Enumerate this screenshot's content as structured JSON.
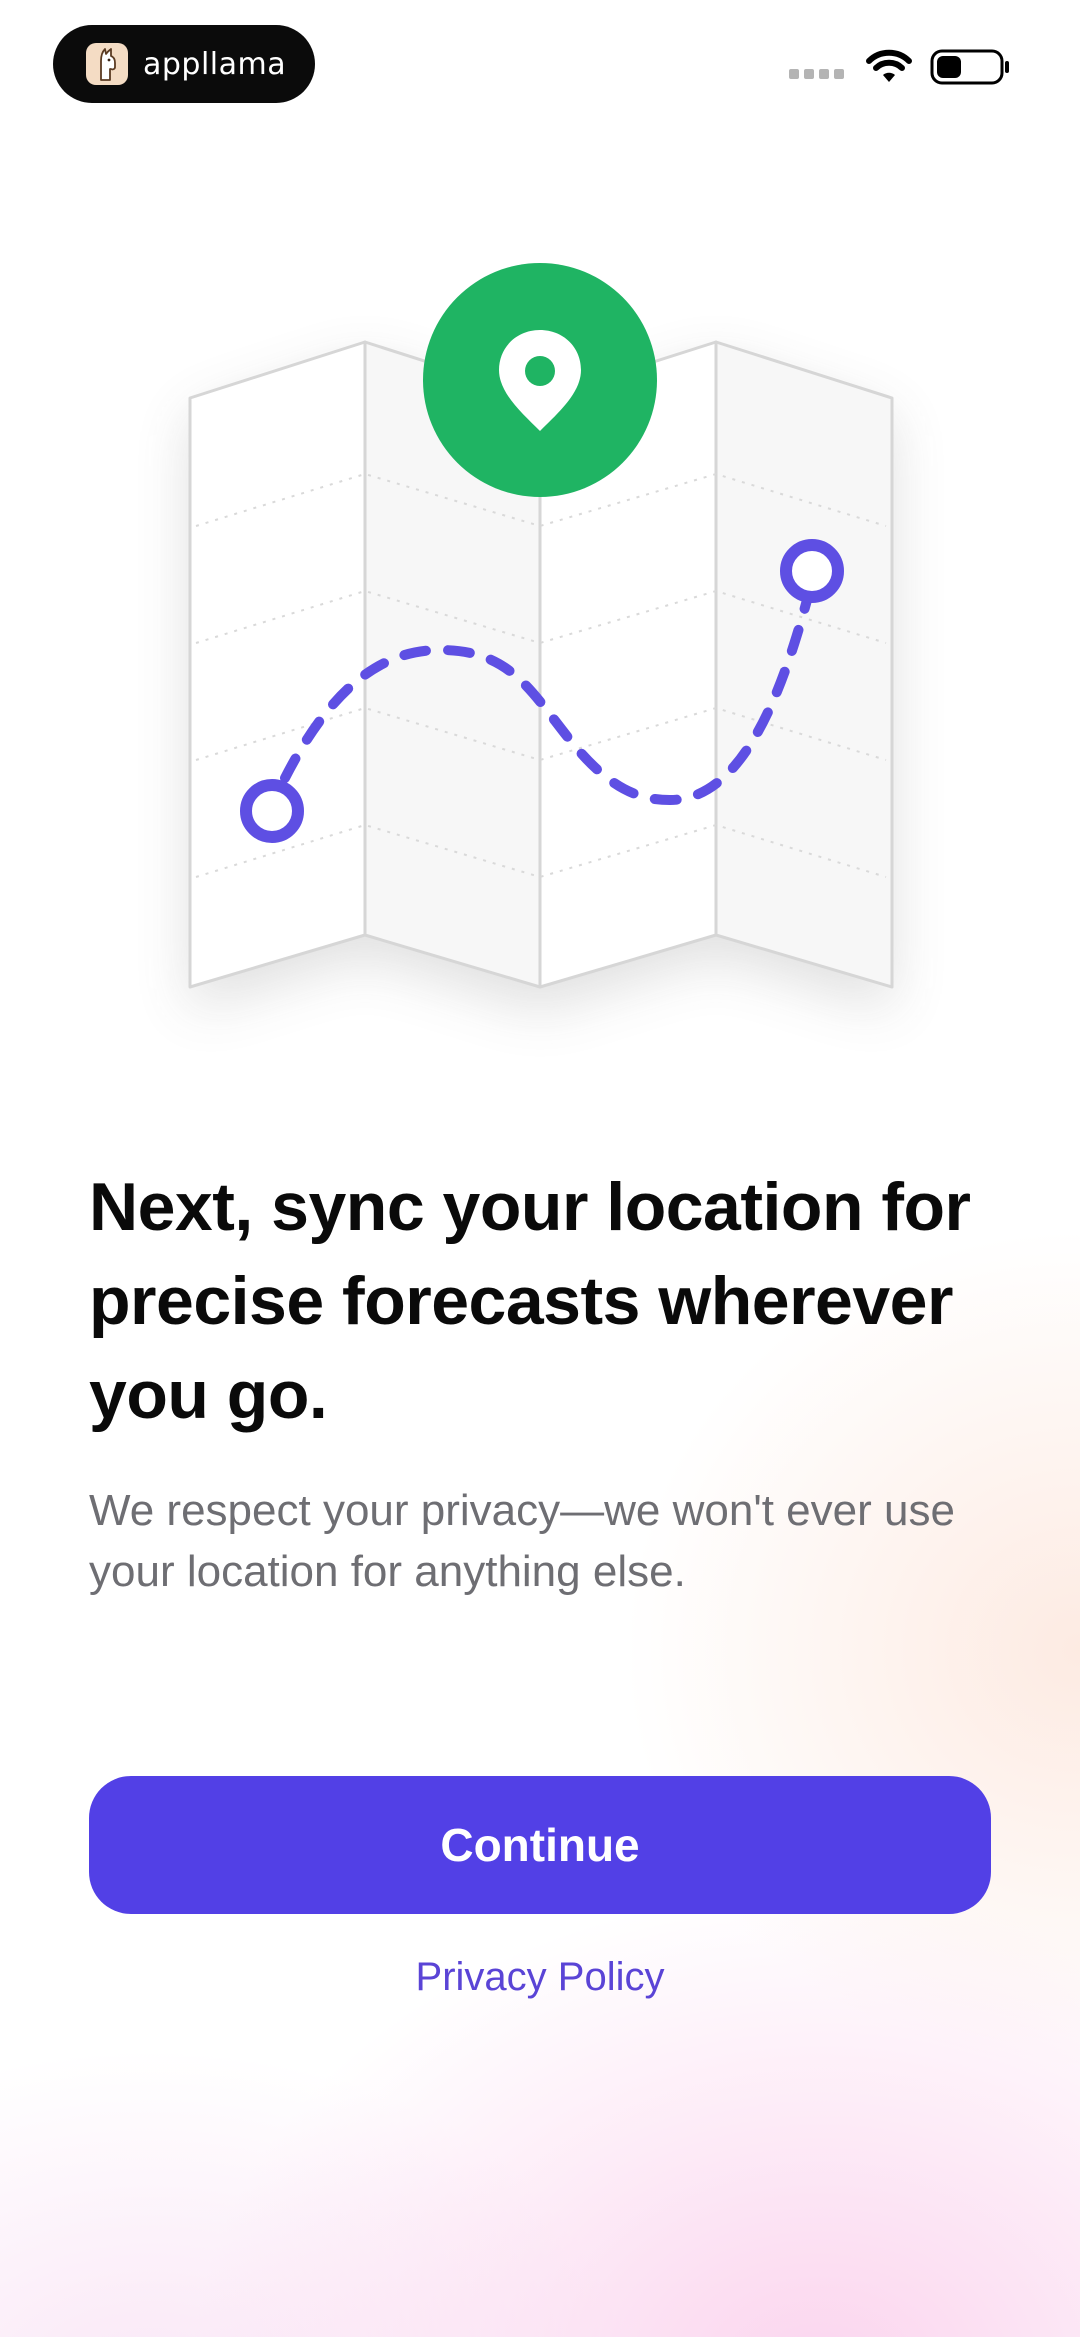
{
  "status_bar": {
    "brand_name": "appllama",
    "brand_icon": "llama-icon",
    "signal_icon": "signal-dots-icon",
    "wifi_icon": "wifi-icon",
    "battery_icon": "battery-icon"
  },
  "illustration": {
    "map_icon": "folded-map-icon",
    "pin_icon": "location-pin-icon",
    "route_icon": "dashed-route-icon",
    "pin_color": "#1fb463",
    "route_color": "#5e4fe3"
  },
  "content": {
    "headline": "Next, sync your location for precise forecasts wherever you go.",
    "subtext": "We respect your privacy—we won't ever use your location for anything else."
  },
  "actions": {
    "continue_label": "Continue",
    "privacy_label": "Privacy Policy"
  },
  "colors": {
    "accent": "#5240e6",
    "link": "#5a44d6",
    "headline": "#0a0a0a",
    "body_text": "#6e6e73"
  }
}
